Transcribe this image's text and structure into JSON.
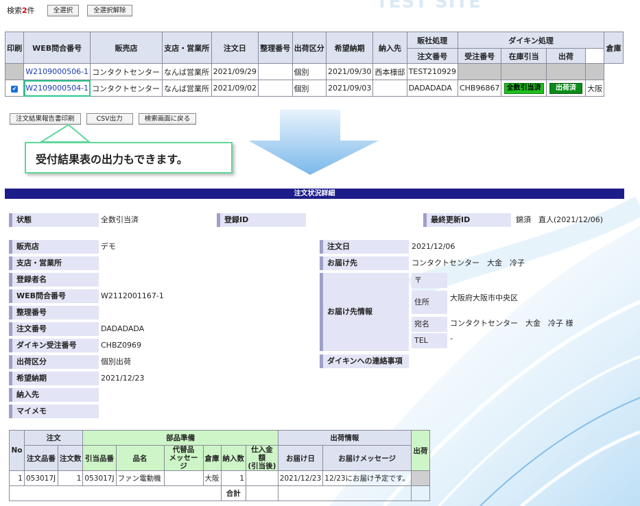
{
  "top": {
    "hits_prefix": "検索",
    "hits_count": "2",
    "hits_suffix": "件",
    "select_all": "全選択",
    "deselect_all": "全選択解除",
    "watermark": "TEST SITE"
  },
  "list": {
    "headers": {
      "print": "印刷",
      "web_no": "WEB問合番号",
      "dealer": "販売店",
      "branch": "支店・営業所",
      "order_date": "注文日",
      "ref_no": "整理番号",
      "ship_type": "出荷区分",
      "desired": "希望納期",
      "deliver_to": "納入先",
      "sales_proc": "販社処理",
      "daikin_proc": "ダイキン処理",
      "order_no": "注文番号",
      "receipt_no": "受注番号",
      "stock": "在庫引当",
      "ship": "出荷",
      "warehouse": "倉庫"
    },
    "rows": [
      {
        "web_no": "W2109000506-1",
        "dealer": "コンタクトセンター",
        "branch": "なんば営業所",
        "order_date": "2021/09/29",
        "ref_no": "",
        "ship_type": "個別",
        "desired": "2021/09/30",
        "deliver_to": "西本様邸",
        "order_no": "TEST210929",
        "receipt_no": "",
        "stock": "",
        "ship": "",
        "warehouse": ""
      },
      {
        "checked": "✔",
        "web_no": "W2109000504-1",
        "dealer": "コンタクトセンター",
        "branch": "なんば営業所",
        "order_date": "2021/09/02",
        "ref_no": "",
        "ship_type": "個別",
        "desired": "2021/09/03",
        "deliver_to": "",
        "order_no": "DADADADA",
        "receipt_no": "CHB96867",
        "stock": "全数引当済",
        "ship": "出荷済",
        "warehouse": "大阪"
      }
    ]
  },
  "actions": {
    "print_report": "注文結果報告書印刷",
    "csv": "CSV出力",
    "back": "検索画面に戻る"
  },
  "callout": "受付結果表の出力もできます。",
  "detail": {
    "title": "注文状況詳細",
    "status_label": "状態",
    "status": "全数引当済",
    "reg_id_label": "登録ID",
    "reg_id": "",
    "last_id_label": "最終更新ID",
    "last_id": "錦須　直人(2021/12/06)",
    "dealer_label": "販売店",
    "dealer": "デモ",
    "branch_label": "支店・営業所",
    "branch": "",
    "registrant_label": "登録者名",
    "registrant": "",
    "web_no_label": "WEB問合番号",
    "web_no": "W2112001167-1",
    "ref_label": "整理番号",
    "ref": "",
    "order_no_label": "注文番号",
    "order_no": "DADADADA",
    "daikin_no_label": "ダイキン受注番号",
    "daikin_no": "CHBZ0969",
    "ship_type_label": "出荷区分",
    "ship_type": "個別出荷",
    "desired_label": "希望納期",
    "desired": "2021/12/23",
    "deliver_label": "納入先",
    "deliver": "",
    "memo_label": "マイメモ",
    "memo": "",
    "order_date_label": "注文日",
    "order_date": "2021/12/06",
    "dest_label": "お届け先",
    "dest": "コンタクトセンター　大金　冷子",
    "dest_info_label": "お届け先情報",
    "zip_label": "〒",
    "zip": "",
    "address_label": "住所",
    "address": "大阪府大阪市中央区",
    "addressee_label": "宛名",
    "addressee": "コンタクトセンター　大金　冷子 様",
    "tel_label": "TEL",
    "tel": "-",
    "contact_label": "ダイキンへの連絡事項",
    "contact": ""
  },
  "parts": {
    "h": {
      "no": "No",
      "order": "注文",
      "parts_prep": "部品準備",
      "ship_info": "出荷情報",
      "ship": "出荷",
      "order_part": "注文品番",
      "order_qty": "注文数",
      "alloc_part": "引当品番",
      "name": "品名",
      "substitute": "代替品\nメッセージ",
      "warehouse": "倉庫",
      "deliver_qty": "納入数",
      "price": "仕入金額\n(引当後)",
      "deliver_date": "お届け日",
      "deliver_msg": "お届けメッセージ",
      "total": "合計"
    },
    "rows": [
      {
        "no": "1",
        "order_part": "053017J",
        "order_qty": "1",
        "alloc_part": "053017J",
        "name": "ファン電動機",
        "substitute": "",
        "warehouse": "大阪",
        "deliver_qty": "1",
        "price": "",
        "deliver_date": "2021/12/23",
        "deliver_msg": "12/23にお届け予定です。"
      }
    ]
  },
  "colors": {
    "header_bar": "#1c1c8a",
    "label_bg": "#e3e4f5",
    "table_head": "#dde2f0",
    "green_head": "#cdf5c7",
    "highlight": "#2ec58d",
    "link": "#1a3bb0"
  }
}
